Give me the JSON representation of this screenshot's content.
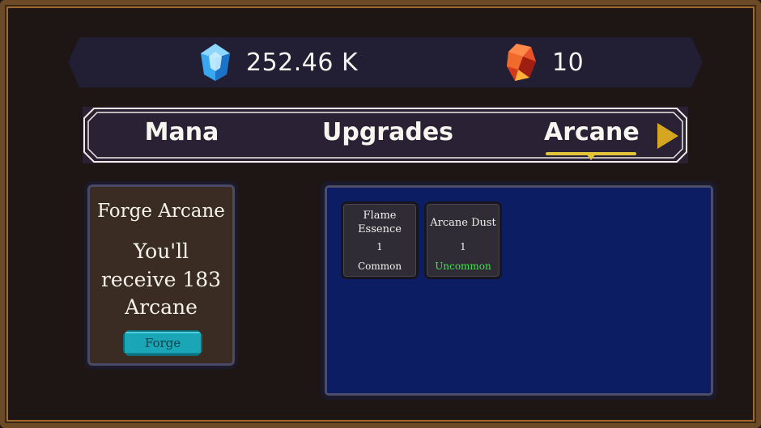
{
  "currencies": {
    "mana": {
      "icon": "blue-crystal-icon",
      "value": "252.46 K"
    },
    "arcane": {
      "icon": "red-gem-icon",
      "value": "10"
    }
  },
  "tabs": [
    {
      "label": "Mana",
      "active": false
    },
    {
      "label": "Upgrades",
      "active": false
    },
    {
      "label": "Arcane",
      "active": true
    }
  ],
  "forge": {
    "title": "Forge Arcane",
    "line1": "You'll",
    "line2": "receive 183",
    "line3": "Arcane",
    "button_label": "Forge"
  },
  "inventory": {
    "items": [
      {
        "name": "Flame\nEssence",
        "quantity": "1",
        "rarity": "Common",
        "rarity_color": "#f3f1ec"
      },
      {
        "name": "Arcane Dust",
        "quantity": "1",
        "rarity": "Uncommon",
        "rarity_color": "#3ee84a"
      }
    ]
  },
  "colors": {
    "tab_underline": "#e3c338",
    "forge_button": "#1aa6b6",
    "inventory_background": "#0c1d63",
    "uncommon": "#3ee84a"
  }
}
